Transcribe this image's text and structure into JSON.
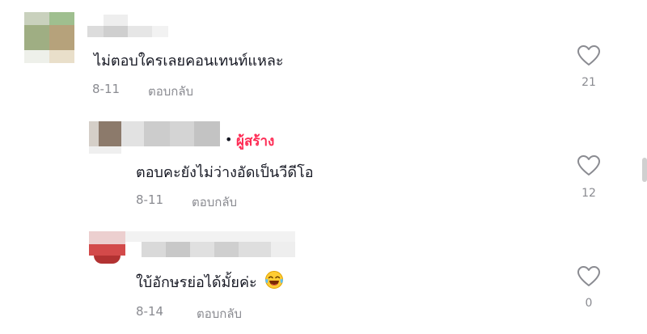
{
  "comments": [
    {
      "text": "ไม่ตอบใครเลยคอนเทนท์แหละ",
      "date": "8-11",
      "reply_label": "ตอบกลับ",
      "likes": "21"
    },
    {
      "creator_badge": "ผู้สร้าง",
      "text": "ตอบคะยังไม่ว่างอัดเป็นวีดีโอ",
      "date": "8-11",
      "reply_label": "ตอบกลับ",
      "likes": "12"
    },
    {
      "text": "ใบ้อักษรย่อได้มั้ยค่ะ",
      "emoji": "face-with-tears-of-joy",
      "date": "8-14",
      "reply_label": "ตอบกลับ",
      "likes": "0"
    }
  ],
  "icons": {
    "like": "heart-outline-icon"
  },
  "colors": {
    "creator": "#fe2c55",
    "meta": "#8a8b91",
    "text": "#161823"
  }
}
